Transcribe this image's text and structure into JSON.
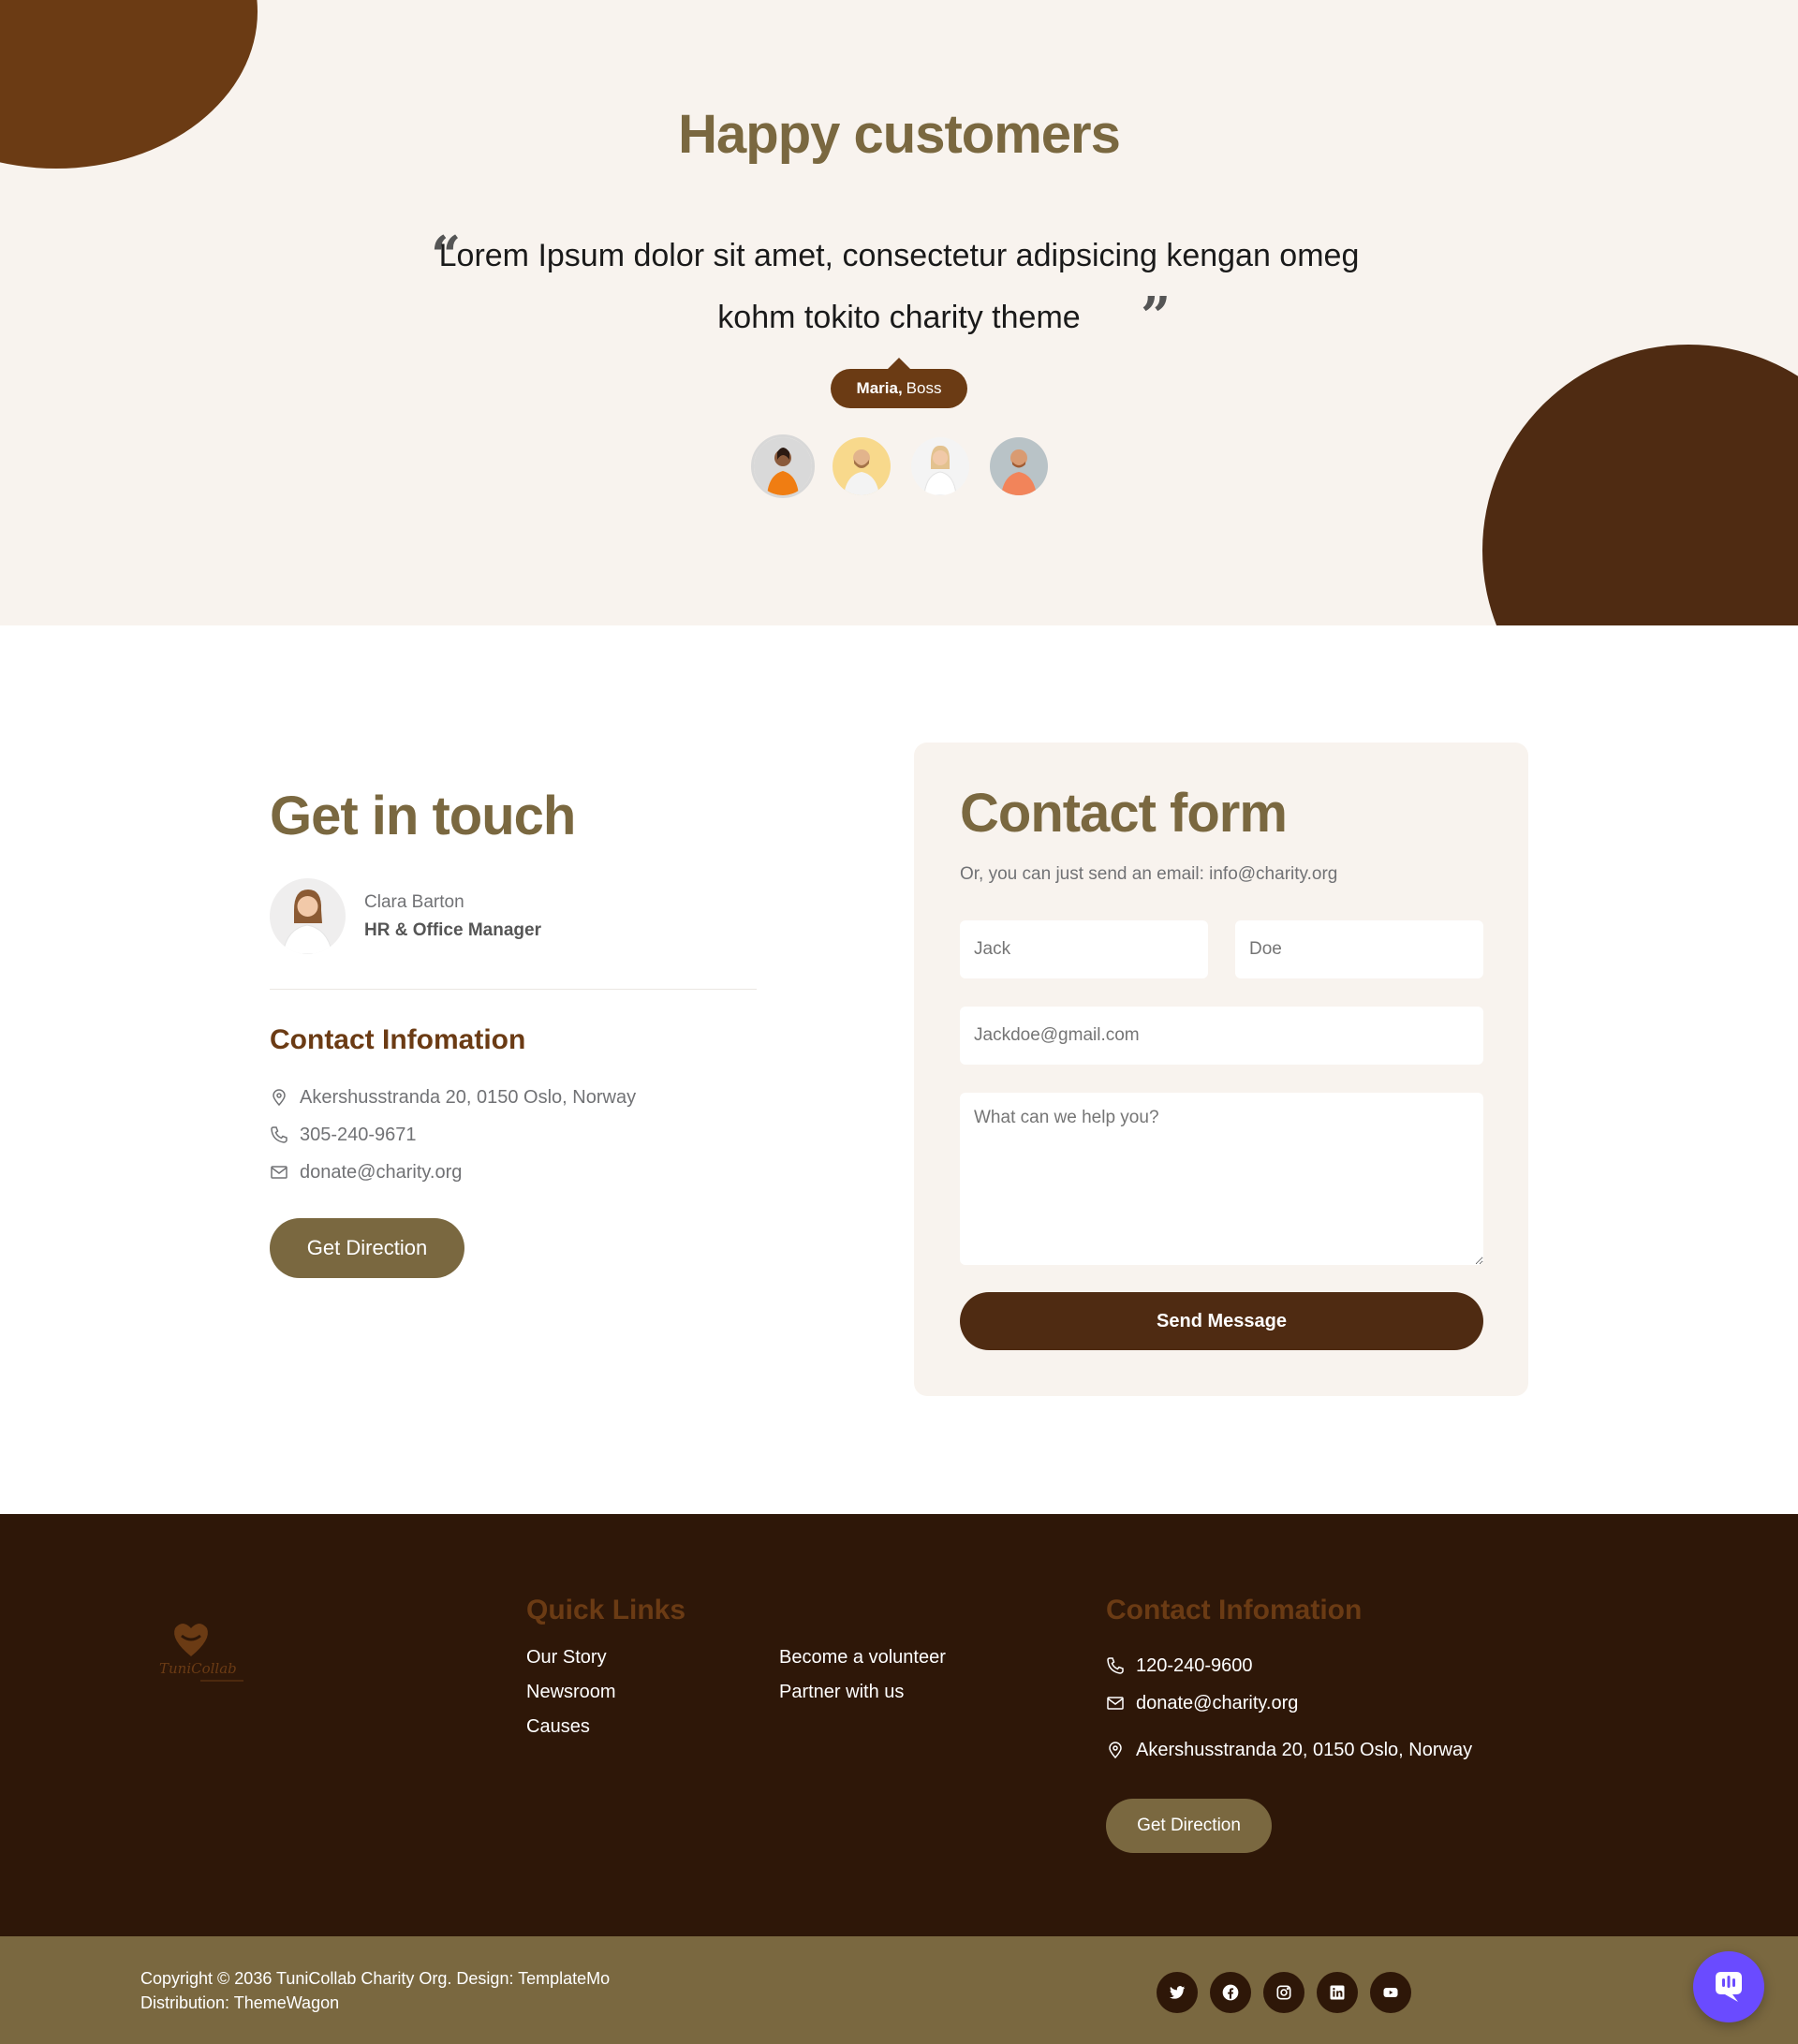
{
  "testimonials": {
    "title": "Happy customers",
    "quote": "Lorem Ipsum dolor sit amet, consectetur adipsicing kengan omeg kohm tokito charity theme",
    "open_quote": "“",
    "close_quote": "”",
    "author_name": "Maria,",
    "author_role": "Boss",
    "avatars": [
      "avatar-woman-orange",
      "avatar-man-beard",
      "avatar-woman-blonde",
      "avatar-man-orange"
    ]
  },
  "get_in_touch": {
    "title": "Get in touch",
    "person_name": "Clara Barton",
    "person_role": "HR & Office Manager",
    "contact_title": "Contact Infomation",
    "address": "Akershusstranda 20, 0150 Oslo, Norway",
    "phone": "305-240-9671",
    "email": "donate@charity.org",
    "button": "Get Direction"
  },
  "contact_form": {
    "title": "Contact form",
    "subtitle": "Or, you can just send an email: info@charity.org",
    "first_name_placeholder": "Jack",
    "last_name_placeholder": "Doe",
    "email_placeholder": "Jackdoe@gmail.com",
    "message_placeholder": "What can we help you?",
    "submit": "Send Message"
  },
  "footer": {
    "logo_text": "TuniCollab",
    "quick_links_title": "Quick Links",
    "links_col1": [
      "Our Story",
      "Newsroom",
      "Causes"
    ],
    "links_col2": [
      "Become a volunteer",
      "Partner with us"
    ],
    "contact_title": "Contact Infomation",
    "phone": "120-240-9600",
    "email": "donate@charity.org",
    "address": "Akershusstranda 20, 0150 Oslo, Norway",
    "button": "Get Direction"
  },
  "sub_footer": {
    "copyright": "Copyright © 2036 TuniCollab Charity Org. Design: TemplateMo",
    "distribution": "Distribution: ThemeWagon",
    "socials": [
      "twitter-icon",
      "facebook-icon",
      "instagram-icon",
      "linkedin-icon",
      "youtube-icon"
    ]
  },
  "colors": {
    "brand_brown": "#7a6840",
    "dark_brown": "#4f2b12",
    "accent_brown": "#6b3b14",
    "footer_bg": "#2e1708",
    "cream": "#f8f3ee",
    "chat_purple": "#6a4bff"
  }
}
